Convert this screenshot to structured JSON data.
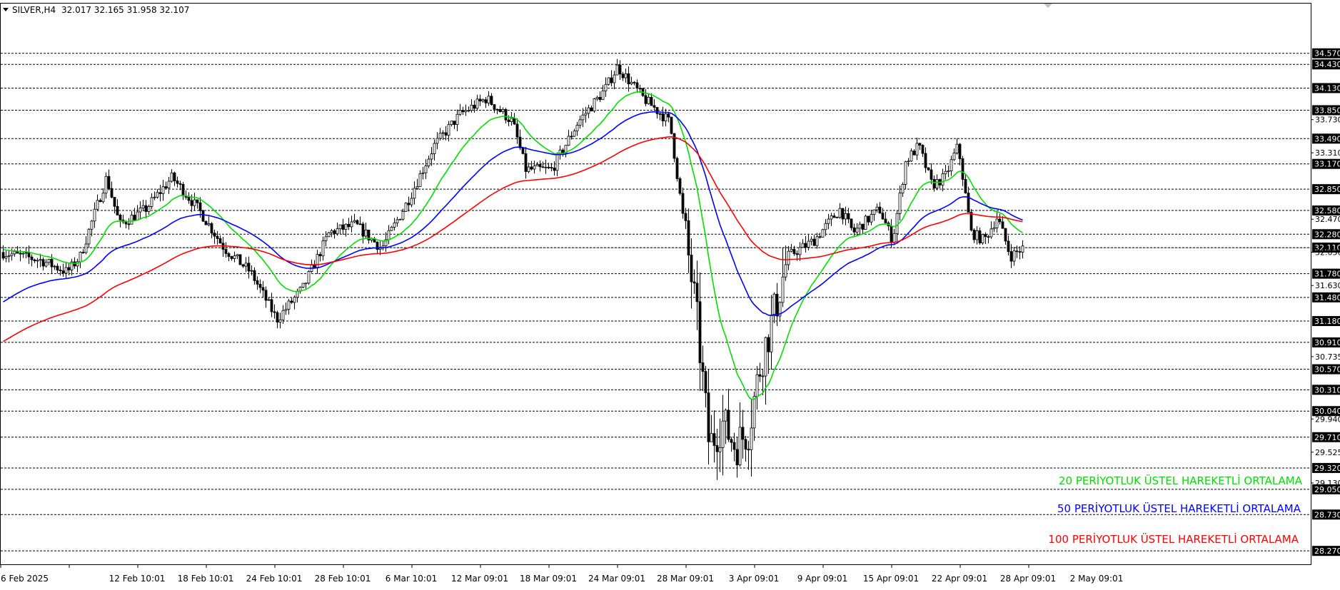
{
  "header": {
    "symbol_timeframe": "SILVER,H4",
    "ohlc": "32.017 32.165 31.958 32.107"
  },
  "colors": {
    "ema20": "#00e000",
    "ema50": "#0000ff",
    "ema100": "#ff0000",
    "level_line": "#000000",
    "current_price_line": "#c0c0c0",
    "candle": "#000000"
  },
  "legend": [
    {
      "label": "20 PERİYOTLUK ÜSTEL HAREKETLİ ORTALAMA",
      "color": "#00e000"
    },
    {
      "label": "50 PERİYOTLUK ÜSTEL HAREKETLİ ORTALAMA",
      "color": "#0000ff"
    },
    {
      "label": "100 PERİYOTLUK ÜSTEL HAREKETLİ ORTALAMA",
      "color": "#ff0000"
    }
  ],
  "chart_data": {
    "type": "candlestick",
    "instrument": "SILVER",
    "timeframe": "H4",
    "ylim": [
      28.1,
      35.2
    ],
    "x_tick_labels": [
      "6 Feb 2025",
      "12 Feb 10:01",
      "18 Feb 10:01",
      "24 Feb 10:01",
      "28 Feb 10:01",
      "6 Mar 10:01",
      "12 Mar 09:01",
      "18 Mar 09:01",
      "24 Mar 09:01",
      "28 Mar 09:01",
      "3 Apr 09:01",
      "9 Apr 09:01",
      "15 Apr 09:01",
      "22 Apr 09:01",
      "28 Apr 09:01",
      "2 May 09:01"
    ],
    "y_tick_labels": [
      {
        "value": 33.73,
        "label": "33.730"
      },
      {
        "value": 33.31,
        "label": "33.310"
      },
      {
        "value": 32.47,
        "label": "32.470"
      },
      {
        "value": 32.05,
        "label": "32.050"
      },
      {
        "value": 31.63,
        "label": "31.630"
      },
      {
        "value": 30.73,
        "label": "30.735"
      },
      {
        "value": 29.94,
        "label": "29.940"
      },
      {
        "value": 29.52,
        "label": "29.525"
      },
      {
        "value": 29.13,
        "label": "29.130"
      }
    ],
    "level_lines": [
      {
        "value": 34.57,
        "label": "34.570"
      },
      {
        "value": 34.43,
        "label": "34.430"
      },
      {
        "value": 34.13,
        "label": "34.130"
      },
      {
        "value": 33.85,
        "label": "33.850"
      },
      {
        "value": 33.49,
        "label": "33.490"
      },
      {
        "value": 33.17,
        "label": "33.170"
      },
      {
        "value": 32.85,
        "label": "32.850"
      },
      {
        "value": 32.58,
        "label": "32.580"
      },
      {
        "value": 32.28,
        "label": "32.280"
      },
      {
        "value": 32.11,
        "label": "32.110"
      },
      {
        "value": 31.78,
        "label": "31.780"
      },
      {
        "value": 31.48,
        "label": "31.480"
      },
      {
        "value": 31.18,
        "label": "31.180"
      },
      {
        "value": 30.91,
        "label": "30.910"
      },
      {
        "value": 30.57,
        "label": "30.570"
      },
      {
        "value": 30.31,
        "label": "30.310"
      },
      {
        "value": 30.04,
        "label": "30.040"
      },
      {
        "value": 29.71,
        "label": "29.710"
      },
      {
        "value": 29.32,
        "label": "29.320"
      },
      {
        "value": 29.05,
        "label": "29.050"
      },
      {
        "value": 28.73,
        "label": "28.730"
      },
      {
        "value": 28.27,
        "label": "28.270"
      }
    ],
    "current_price": 32.107,
    "price_path": [
      {
        "t": 0.0,
        "p": 32.05
      },
      {
        "t": 0.03,
        "p": 31.95
      },
      {
        "t": 0.05,
        "p": 31.8
      },
      {
        "t": 0.06,
        "p": 32.0
      },
      {
        "t": 0.08,
        "p": 33.0
      },
      {
        "t": 0.09,
        "p": 32.4
      },
      {
        "t": 0.11,
        "p": 32.6
      },
      {
        "t": 0.13,
        "p": 33.0
      },
      {
        "t": 0.15,
        "p": 32.6
      },
      {
        "t": 0.17,
        "p": 32.1
      },
      {
        "t": 0.19,
        "p": 31.8
      },
      {
        "t": 0.21,
        "p": 31.2
      },
      {
        "t": 0.23,
        "p": 31.6
      },
      {
        "t": 0.25,
        "p": 32.3
      },
      {
        "t": 0.27,
        "p": 32.4
      },
      {
        "t": 0.29,
        "p": 32.1
      },
      {
        "t": 0.31,
        "p": 32.7
      },
      {
        "t": 0.33,
        "p": 33.4
      },
      {
        "t": 0.35,
        "p": 33.8
      },
      {
        "t": 0.37,
        "p": 34.0
      },
      {
        "t": 0.39,
        "p": 33.7
      },
      {
        "t": 0.4,
        "p": 33.1
      },
      {
        "t": 0.42,
        "p": 33.1
      },
      {
        "t": 0.44,
        "p": 33.7
      },
      {
        "t": 0.46,
        "p": 34.1
      },
      {
        "t": 0.47,
        "p": 34.4
      },
      {
        "t": 0.49,
        "p": 34.0
      },
      {
        "t": 0.51,
        "p": 33.7
      },
      {
        "t": 0.52,
        "p": 32.5
      },
      {
        "t": 0.53,
        "p": 31.3
      },
      {
        "t": 0.54,
        "p": 29.6
      },
      {
        "t": 0.55,
        "p": 29.9
      },
      {
        "t": 0.56,
        "p": 29.6
      },
      {
        "t": 0.57,
        "p": 29.8
      },
      {
        "t": 0.58,
        "p": 30.7
      },
      {
        "t": 0.59,
        "p": 31.3
      },
      {
        "t": 0.6,
        "p": 32.0
      },
      {
        "t": 0.62,
        "p": 32.2
      },
      {
        "t": 0.64,
        "p": 32.6
      },
      {
        "t": 0.65,
        "p": 32.3
      },
      {
        "t": 0.67,
        "p": 32.6
      },
      {
        "t": 0.68,
        "p": 32.2
      },
      {
        "t": 0.69,
        "p": 33.2
      },
      {
        "t": 0.7,
        "p": 33.4
      },
      {
        "t": 0.71,
        "p": 32.9
      },
      {
        "t": 0.72,
        "p": 33.0
      },
      {
        "t": 0.73,
        "p": 33.4
      },
      {
        "t": 0.74,
        "p": 32.3
      },
      {
        "t": 0.75,
        "p": 32.2
      },
      {
        "t": 0.76,
        "p": 32.5
      },
      {
        "t": 0.77,
        "p": 32.0
      },
      {
        "t": 0.78,
        "p": 32.11
      }
    ]
  }
}
